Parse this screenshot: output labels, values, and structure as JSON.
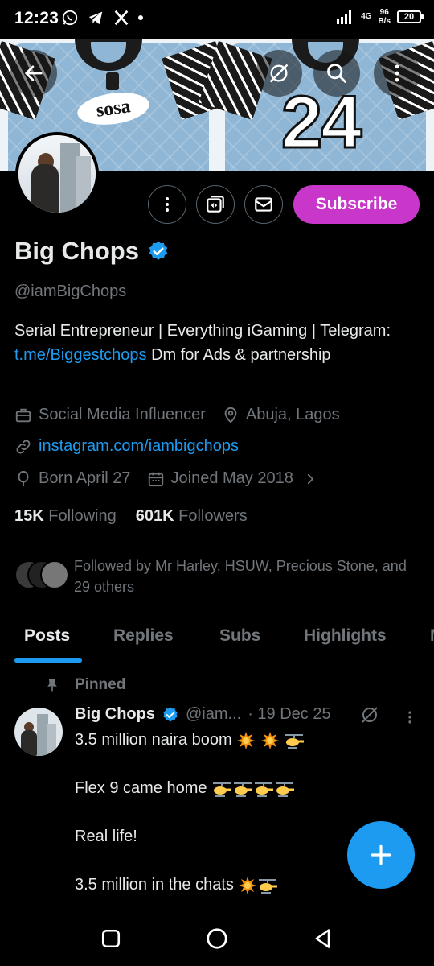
{
  "status_bar": {
    "time": "12:23",
    "network": "4G",
    "speed_value": "96",
    "speed_unit": "B/s",
    "battery": "20"
  },
  "banner": {
    "sponsor": "sosa",
    "number": "24"
  },
  "actions": {
    "subscribe_label": "Subscribe"
  },
  "profile": {
    "name": "Big Chops",
    "handle": "@iamBigChops",
    "bio_prefix": "Serial Entrepreneur | Everything iGaming | Telegram: ",
    "bio_link": "t.me/Biggestchops",
    "bio_suffix": " Dm for Ads & partnership",
    "profession": "Social Media Influencer",
    "location": "Abuja, Lagos",
    "website": "instagram.com/iambigchops",
    "born": "Born April 27",
    "joined": "Joined May 2018",
    "following_count": "15K",
    "following_label": "Following",
    "followers_count": "601K",
    "followers_label": "Followers",
    "followed_by": "Followed by Mr Harley, HSUW, Precious Stone, and 29 others"
  },
  "tabs": [
    {
      "label": "Posts"
    },
    {
      "label": "Replies"
    },
    {
      "label": "Subs"
    },
    {
      "label": "Highlights"
    },
    {
      "label": "M"
    }
  ],
  "post": {
    "pinned_label": "Pinned",
    "author": "Big Chops",
    "handle": "@iam...",
    "date": "· 19 Dec 25",
    "line1": "3.5 million naira boom",
    "line2": "Flex 9 came home",
    "line3": "Real life!",
    "line4": "3.5 million in the chats"
  },
  "colors": {
    "accent": "#1d9bf0",
    "subscribe": "#c837c9",
    "muted": "#71767b",
    "text": "#e7e9ea"
  },
  "icons": [
    "back-arrow-icon",
    "grok-icon",
    "search-icon",
    "more-vertical-icon",
    "spaces-icon",
    "message-icon",
    "verified-badge-icon",
    "briefcase-icon",
    "location-icon",
    "link-icon",
    "balloon-icon",
    "calendar-icon",
    "chevron-right-icon",
    "pin-icon",
    "boom-emoji",
    "helicopter-emoji",
    "plus-icon",
    "recents-icon",
    "home-icon",
    "back-icon"
  ]
}
